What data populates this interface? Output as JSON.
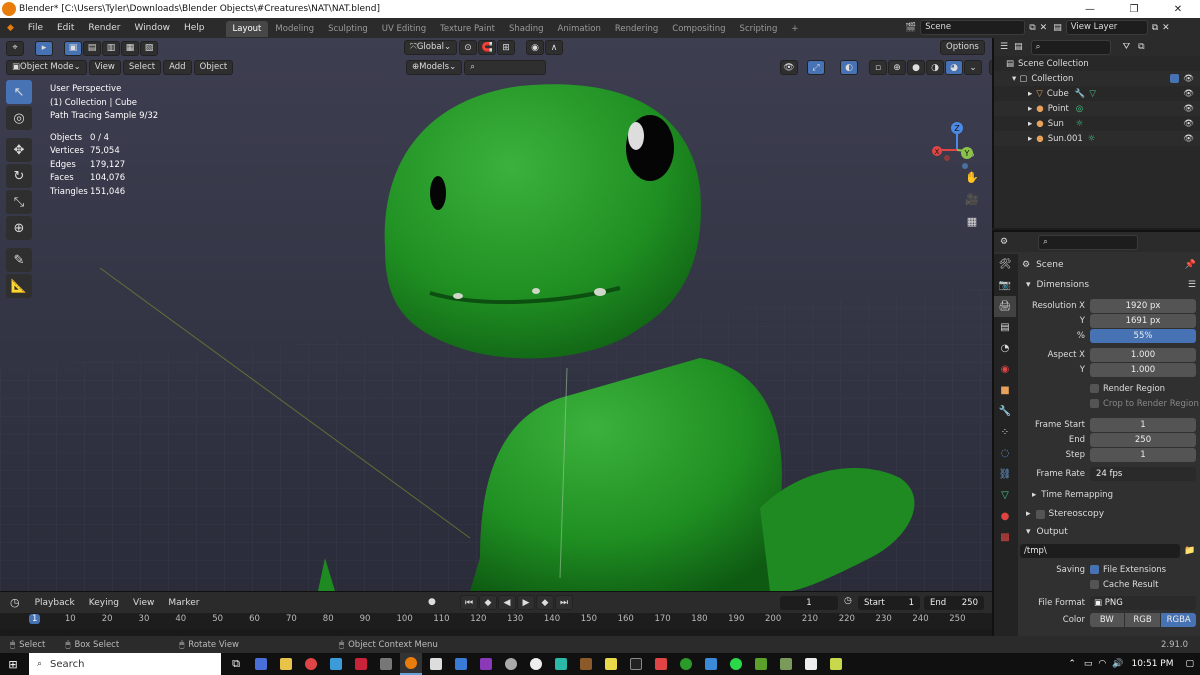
{
  "window": {
    "title": "Blender* [C:\\Users\\Tyler\\Downloads\\Blender Objects\\#Creatures\\NAT\\NAT.blend]",
    "minimize": "—",
    "maximize": "❐",
    "close": "✕"
  },
  "menu": [
    "File",
    "Edit",
    "Render",
    "Window",
    "Help"
  ],
  "workspaces": [
    "Layout",
    "Modeling",
    "Sculpting",
    "UV Editing",
    "Texture Paint",
    "Shading",
    "Animation",
    "Rendering",
    "Compositing",
    "Scripting"
  ],
  "add_workspace": "+",
  "scene_name": "Scene",
  "view_layer": "View Layer",
  "viewport": {
    "transform_orientation": "Global",
    "options_label": "Options",
    "mode": "Object Mode",
    "menus": [
      "View",
      "Select",
      "Add",
      "Object"
    ],
    "models_label": "Models",
    "overlay_lines": [
      "User Perspective",
      "(1) Collection | Cube",
      "Path Tracing Sample 9/32"
    ],
    "stats": [
      {
        "label": "Objects",
        "value": "0 / 4"
      },
      {
        "label": "Vertices",
        "value": "75,054"
      },
      {
        "label": "Edges",
        "value": "179,127"
      },
      {
        "label": "Faces",
        "value": "104,076"
      },
      {
        "label": "Triangles",
        "value": "151,046"
      }
    ],
    "gizmo": {
      "z": "Z",
      "y": "Y",
      "x": "X"
    }
  },
  "timeline": {
    "menus": [
      "Playback",
      "Keying",
      "View",
      "Marker"
    ],
    "current_frame": "1",
    "start_label": "Start",
    "start": "1",
    "end_label": "End",
    "end": "250",
    "ticks": [
      "1",
      "10",
      "20",
      "30",
      "40",
      "50",
      "60",
      "70",
      "80",
      "90",
      "100",
      "110",
      "120",
      "130",
      "140",
      "150",
      "160",
      "170",
      "180",
      "190",
      "200",
      "210",
      "220",
      "230",
      "240",
      "250"
    ]
  },
  "statusbar": {
    "select": "Select",
    "box_select": "Box Select",
    "rotate_view": "Rotate View",
    "context_menu": "Object Context Menu",
    "version": "2.91.0"
  },
  "outliner": {
    "root": "Scene Collection",
    "collection": "Collection",
    "items": [
      "Cube",
      "Point",
      "Sun",
      "Sun.001"
    ]
  },
  "properties": {
    "context": "Scene",
    "dimensions_header": "Dimensions",
    "resolution_x_label": "Resolution X",
    "resolution_x": "1920 px",
    "resolution_y_label": "Y",
    "resolution_y": "1691 px",
    "percent_label": "%",
    "percent": "55%",
    "aspect_x_label": "Aspect X",
    "aspect_x": "1.000",
    "aspect_y_label": "Y",
    "aspect_y": "1.000",
    "render_region": "Render Region",
    "crop_region": "Crop to Render Region",
    "frame_start_label": "Frame Start",
    "frame_start": "1",
    "end_label": "End",
    "end": "250",
    "step_label": "Step",
    "step": "1",
    "frame_rate_label": "Frame Rate",
    "frame_rate": "24 fps",
    "time_remapping": "Time Remapping",
    "stereoscopy": "Stereoscopy",
    "output_header": "Output",
    "output_path": "/tmp\\",
    "saving_label": "Saving",
    "file_extensions": "File Extensions",
    "cache_result": "Cache Result",
    "file_format_label": "File Format",
    "file_format": "PNG",
    "color_label": "Color",
    "color_options": [
      "BW",
      "RGB",
      "RGBA"
    ]
  },
  "taskbar": {
    "search": "Search",
    "time": "10:51 PM"
  }
}
